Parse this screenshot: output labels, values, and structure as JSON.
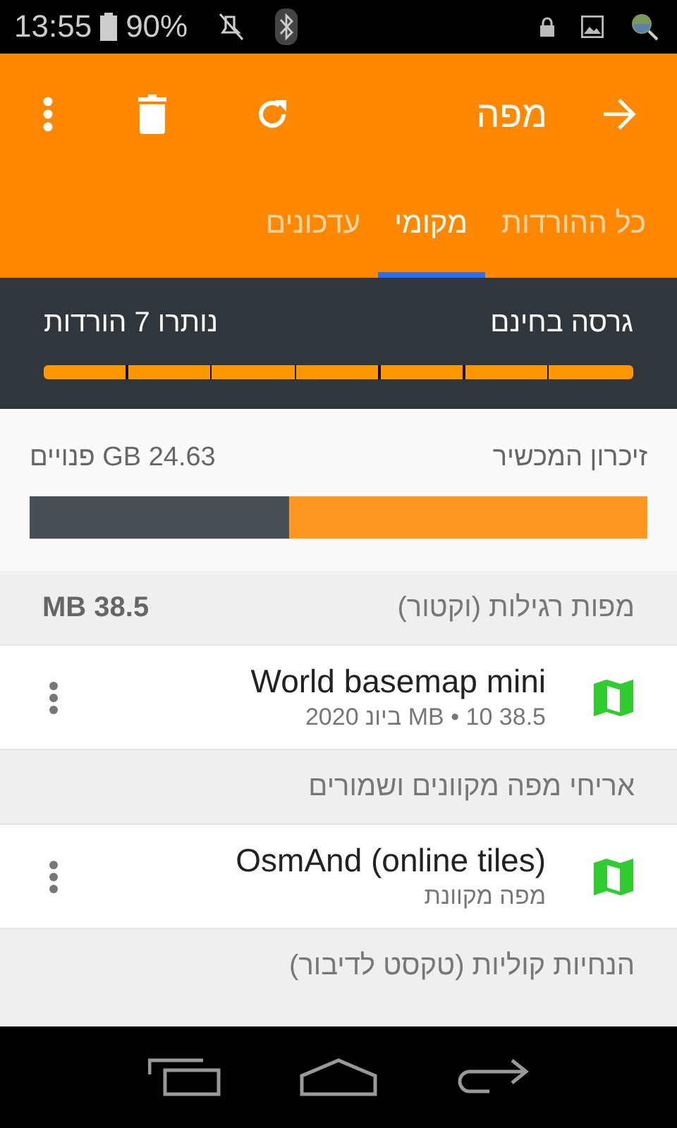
{
  "status_bar": {
    "time": "13:55",
    "battery": "90%"
  },
  "toolbar": {
    "title": "מפה"
  },
  "tabs": [
    {
      "label": "כל ההורדות",
      "selected": false
    },
    {
      "label": "מקומי",
      "selected": true
    },
    {
      "label": "עדכונים",
      "selected": false
    }
  ],
  "free_version": {
    "label": "גרסה בחינם",
    "remaining": "נותרו 7 הורדות",
    "level": 1
  },
  "storage": {
    "label": "זיכרון המכשיר",
    "free": "24.63 GB פנויים",
    "level": 0.58
  },
  "sections": [
    {
      "title": "מפות רגילות (וקטור)",
      "size": "38.5 MB",
      "items": [
        {
          "title": "World basemap mini",
          "subtitle": "38.5 MB • 10 ביונ 2020"
        }
      ]
    },
    {
      "title": "אריחי מפה מקוונים ושמורים",
      "items": [
        {
          "title": "OsmAnd (online tiles)",
          "subtitle": "מפה מקוונת"
        }
      ]
    },
    {
      "title": "הנחיות קוליות (טקסט לדיבור)"
    }
  ]
}
